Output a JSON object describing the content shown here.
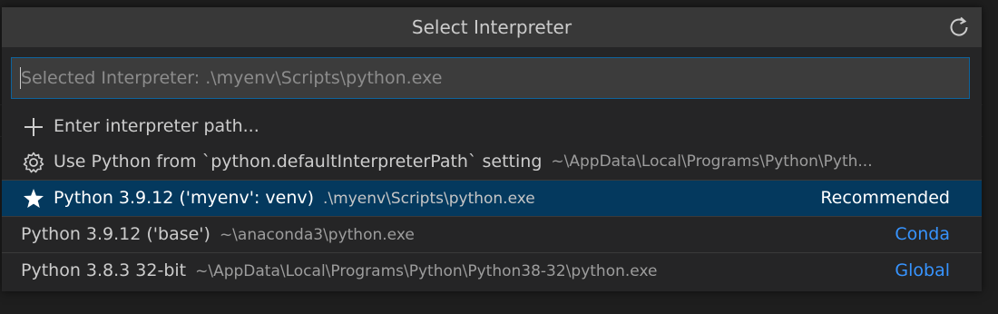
{
  "title": "Select Interpreter",
  "input": {
    "placeholder": "Selected Interpreter: .\\myenv\\Scripts\\python.exe"
  },
  "items": [
    {
      "icon": "add-icon",
      "label": "Enter interpreter path..."
    },
    {
      "icon": "gear-icon",
      "label": "Use Python from `python.defaultInterpreterPath` setting",
      "description": "~\\AppData\\Local\\Programs\\Python\\Pyth..."
    },
    {
      "icon": "star-icon",
      "label": "Python 3.9.12 ('myenv': venv)",
      "description": ".\\myenv\\Scripts\\python.exe",
      "tag": "Recommended"
    },
    {
      "label": "Python 3.9.12 ('base')",
      "description": "~\\anaconda3\\python.exe",
      "tag": "Conda"
    },
    {
      "label": "Python 3.8.3 32-bit",
      "description": "~\\AppData\\Local\\Programs\\Python\\Python38-32\\python.exe",
      "tag": "Global"
    }
  ],
  "colors": {
    "accent_blue": "#3794ff",
    "selection": "#04395e",
    "title_bar": "#383838",
    "panel": "#252526"
  }
}
